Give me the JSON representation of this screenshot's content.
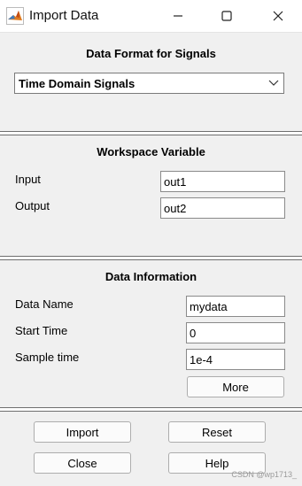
{
  "window": {
    "title": "Import Data"
  },
  "data_format": {
    "heading": "Data Format for Signals",
    "selected": "Time Domain Signals"
  },
  "workspace": {
    "heading": "Workspace Variable",
    "input_label": "Input",
    "input_value": "out1",
    "output_label": "Output",
    "output_value": "out2"
  },
  "data_info": {
    "heading": "Data Information",
    "name_label": "Data Name",
    "name_value": "mydata",
    "start_label": "Start Time",
    "start_value": "0",
    "sample_label": "Sample time",
    "sample_value": "1e-4",
    "more_label": "More"
  },
  "actions": {
    "import_label": "Import",
    "reset_label": "Reset",
    "close_label": "Close",
    "help_label": "Help"
  },
  "watermark": "CSDN @wp1713_",
  "colors": {
    "titlebar": "#ffffff",
    "panel": "#f0f0f0",
    "separator": "#6e6e6e"
  }
}
